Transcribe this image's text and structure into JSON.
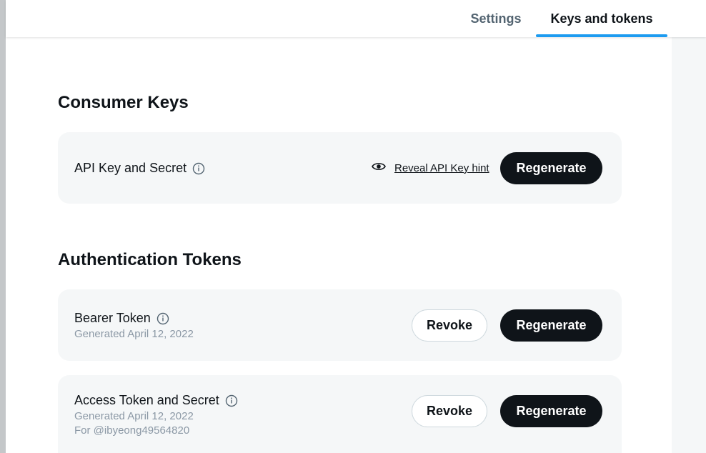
{
  "tabs": {
    "settings": "Settings",
    "keys_and_tokens": "Keys and tokens",
    "active_color": "#1d9bf0"
  },
  "consumer_keys": {
    "title": "Consumer Keys",
    "api_key": {
      "label": "API Key and Secret",
      "info_icon": "info-icon",
      "reveal_icon": "eye-icon",
      "reveal_label": "Reveal API Key hint",
      "regenerate_label": "Regenerate"
    }
  },
  "auth_tokens": {
    "title": "Authentication Tokens",
    "bearer": {
      "label": "Bearer Token",
      "info_icon": "info-icon",
      "generated": "Generated April 12, 2022",
      "revoke_label": "Revoke",
      "regenerate_label": "Regenerate"
    },
    "access": {
      "label": "Access Token and Secret",
      "info_icon": "info-icon",
      "generated": "Generated April 12, 2022",
      "for_user": "For @ibyeong49564820",
      "revoke_label": "Revoke",
      "regenerate_label": "Regenerate"
    }
  }
}
